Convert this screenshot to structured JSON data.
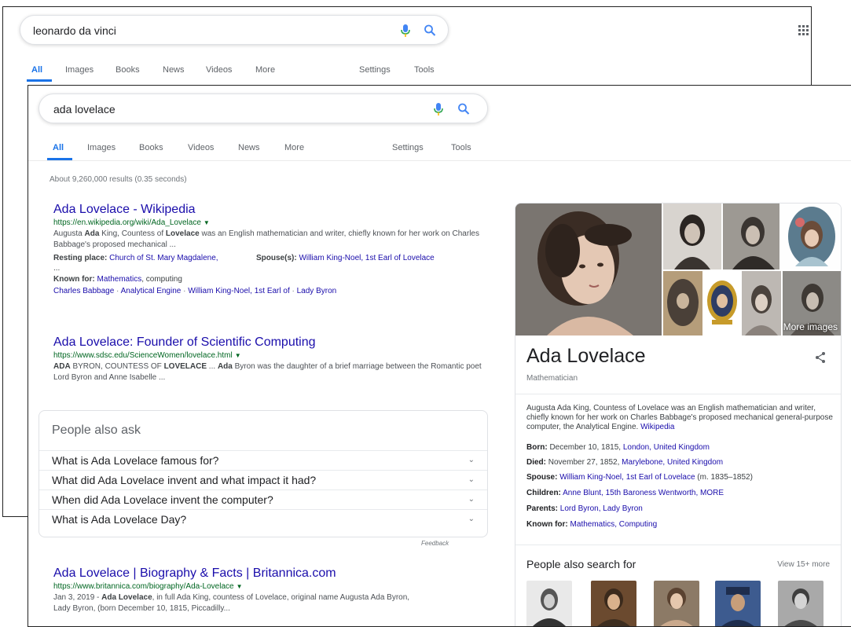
{
  "back_window": {
    "query": "leonardo da vinci",
    "tabs": [
      "All",
      "Images",
      "Books",
      "News",
      "Videos",
      "More"
    ],
    "settings": "Settings",
    "tools": "Tools"
  },
  "front_window": {
    "query": "ada lovelace",
    "tabs": [
      "All",
      "Images",
      "Books",
      "Videos",
      "News",
      "More"
    ],
    "settings": "Settings",
    "tools": "Tools",
    "stats": "About 9,260,000 results (0.35 seconds)"
  },
  "results": {
    "r1": {
      "title": "Ada Lovelace - Wikipedia",
      "url": "https://en.wikipedia.org/wiki/Ada_Lovelace",
      "snippet_1": "Augusta ",
      "snippet_b1": "Ada",
      "snippet_2": " King, Countess of ",
      "snippet_b2": "Lovelace",
      "snippet_3": " was an English mathematician and writer, chiefly known for her work on Charles Babbage's proposed mechanical ...",
      "resting_label": "Resting place:",
      "resting_value": "Church of St. Mary Magdalene,",
      "resting_ellipsis": "...",
      "spouse_label": "Spouse(s):",
      "spouse_value": "William King-Noel, 1st Earl of Lovelace",
      "known_label": "Known for:",
      "known_link": "Mathematics",
      "known_rest": ", computing",
      "sitelinks": [
        "Charles Babbage",
        "Analytical Engine",
        "William King-Noel, 1st Earl of",
        "Lady Byron"
      ]
    },
    "r2": {
      "title": "Ada Lovelace: Founder of Scientific Computing",
      "url": "https://www.sdsc.edu/ScienceWomen/lovelace.html",
      "snippet_b1": "ADA",
      "snippet_1": " BYRON, COUNTESS OF ",
      "snippet_b2": "LOVELACE",
      "snippet_2": " ... ",
      "snippet_b3": "Ada",
      "snippet_3": " Byron was the daughter of a brief marriage between the Romantic poet Lord Byron and Anne Isabelle ..."
    },
    "r3": {
      "title": "Ada Lovelace | Biography & Facts | Britannica.com",
      "url": "https://www.britannica.com/biography/Ada-Lovelace",
      "snippet_1": "Jan 3, 2019 - ",
      "snippet_b1": "Ada Lovelace",
      "snippet_2": ", in full Ada King, countess of Lovelace, original name Augusta Ada Byron,",
      "snippet_3": "Lady Byron, (born December 10, 1815, Piccadilly..."
    }
  },
  "people_also_ask": {
    "heading": "People also ask",
    "questions": [
      "What is Ada Lovelace famous for?",
      "What did Ada Lovelace invent and what impact it had?",
      "When did Ada Lovelace invent the computer?",
      "What is Ada Lovelace Day?"
    ],
    "feedback": "Feedback"
  },
  "knowledge_panel": {
    "more_images": "More images",
    "title": "Ada Lovelace",
    "subtitle": "Mathematician",
    "description": "Augusta Ada King, Countess of Lovelace was an English mathematician and writer, chiefly known for her work on Charles Babbage's proposed mechanical general-purpose computer, the Analytical Engine. ",
    "description_link": "Wikipedia",
    "born_label": "Born:",
    "born_text": " December 10, 1815, ",
    "born_link": "London, United Kingdom",
    "died_label": "Died:",
    "died_text": " November 27, 1852, ",
    "died_link": "Marylebone, United Kingdom",
    "spouse_label": "Spouse:",
    "spouse_link": "William King-Noel, 1st Earl of Lovelace",
    "spouse_text": " (m. 1835–1852)",
    "children_label": "Children:",
    "children_link": "Anne Blunt, 15th Baroness Wentworth, MORE",
    "parents_label": "Parents:",
    "parents_link": "Lord Byron, Lady Byron",
    "known_label": "Known for:",
    "known_link": "Mathematics, Computing",
    "pas_heading": "People also search for",
    "pas_more": "View 15+ more"
  },
  "colors": {
    "link": "#1a0dab",
    "url": "#006621",
    "accent": "#1a73e8"
  }
}
